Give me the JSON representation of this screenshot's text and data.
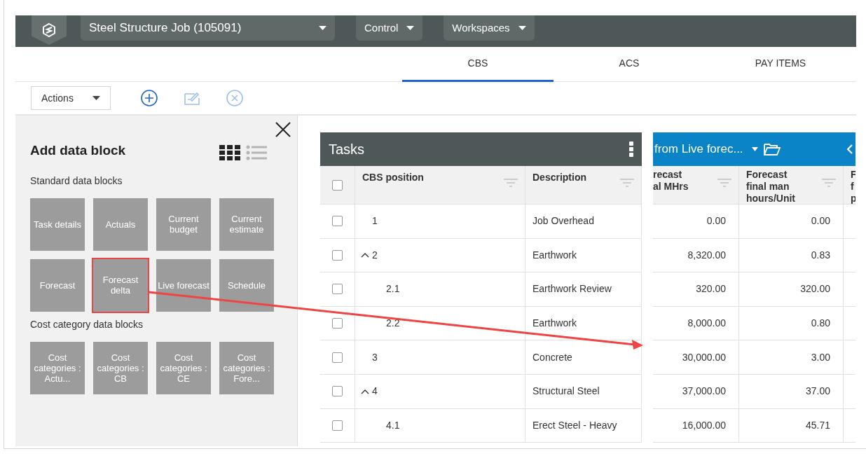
{
  "header": {
    "project": "Steel Structure Job (105091)",
    "menus": [
      "Control",
      "Workspaces"
    ]
  },
  "tabs": [
    {
      "label": "CBS",
      "selected": true
    },
    {
      "label": "ACS",
      "selected": false
    },
    {
      "label": "PAY ITEMS",
      "selected": false
    }
  ],
  "toolbar": {
    "actions_label": "Actions"
  },
  "panel": {
    "title": "Add data block",
    "view_icons": [
      {
        "kind": "grid",
        "selected": true
      },
      {
        "kind": "list",
        "selected": false
      }
    ],
    "sections": [
      {
        "title": "Standard data blocks",
        "blocks": [
          {
            "label": "Task details",
            "highlighted": false
          },
          {
            "label": "Actuals",
            "highlighted": false
          },
          {
            "label": "Current budget",
            "highlighted": false
          },
          {
            "label": "Current estimate",
            "highlighted": false
          },
          {
            "label": "Forecast",
            "highlighted": false
          },
          {
            "label": "Forecast delta",
            "highlighted": true
          },
          {
            "label": "Live forecast",
            "highlighted": false
          },
          {
            "label": "Schedule",
            "highlighted": false
          }
        ]
      },
      {
        "title": "Cost category data blocks",
        "blocks": [
          {
            "label": "Cost categories : Actu...",
            "highlighted": false
          },
          {
            "label": "Cost categories : CB",
            "highlighted": false
          },
          {
            "label": "Cost categories : CE",
            "highlighted": false
          },
          {
            "label": "Cost categories : Fore...",
            "highlighted": false
          }
        ]
      }
    ]
  },
  "tasks": {
    "title": "Tasks",
    "all_checked": false,
    "columns": [
      "CBS position",
      "Description"
    ],
    "rows": [
      {
        "cbs": "1",
        "description": "Job Overhead",
        "checked": false,
        "values": [
          "0.00",
          "0.00"
        ]
      },
      {
        "cbs": "2",
        "description": "Earthwork",
        "checked": false,
        "expanded": true,
        "values": [
          "8,320.00",
          "0.83"
        ],
        "children": [
          {
            "cbs": "2.1",
            "description": "Earthwork Review",
            "checked": false,
            "values": [
              "320.00",
              "320.00"
            ]
          },
          {
            "cbs": "2.2",
            "description": "Earthwork",
            "checked": false,
            "values": [
              "8,000.00",
              "0.80"
            ]
          }
        ]
      },
      {
        "cbs": "3",
        "description": "Concrete",
        "checked": false,
        "values": [
          "30,000.00",
          "3.00"
        ]
      },
      {
        "cbs": "4",
        "description": "Structural Steel",
        "checked": false,
        "expanded": true,
        "values": [
          "37,000.00",
          "37.00"
        ],
        "children": [
          {
            "cbs": "4.1",
            "description": "Erect Steel - Heavy",
            "checked": false,
            "values": [
              "16,000.00",
              "45.71"
            ]
          }
        ]
      }
    ]
  },
  "forecast_panel": {
    "title": "from Live forec...",
    "columns": [
      "recast\nal MHrs",
      "Forecast\nfinal man\nhours/Unit",
      "F\nf\np"
    ]
  }
}
